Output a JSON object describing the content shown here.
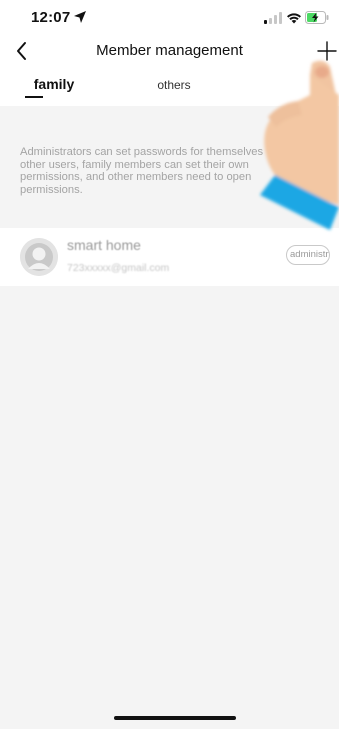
{
  "status_bar": {
    "time": "12:07",
    "icons": [
      "location-arrow-icon",
      "cellular-signal-icon",
      "wifi-icon",
      "battery-charging-icon"
    ]
  },
  "nav": {
    "title": "Member management",
    "back_icon": "chevron-left-icon",
    "add_icon": "plus-icon"
  },
  "tabs": [
    {
      "label": "family",
      "active": true
    },
    {
      "label": "others",
      "active": false
    }
  ],
  "description": "Administrators can set passwords for themselves\nother users, family members can set their own\npermissions, and other members need to open\npermissions.",
  "members": [
    {
      "name": "smart home",
      "email": "723xxxxx@gmail.com",
      "role": "administrator",
      "avatar_icon": "user-avatar-icon"
    }
  ],
  "colors": {
    "background": "#f4f4f4",
    "surface": "#ffffff",
    "text_primary": "#111111",
    "text_secondary": "#a4a4a4",
    "hand_skin": "#f3c6a2",
    "sleeve": "#1ea7e4"
  }
}
